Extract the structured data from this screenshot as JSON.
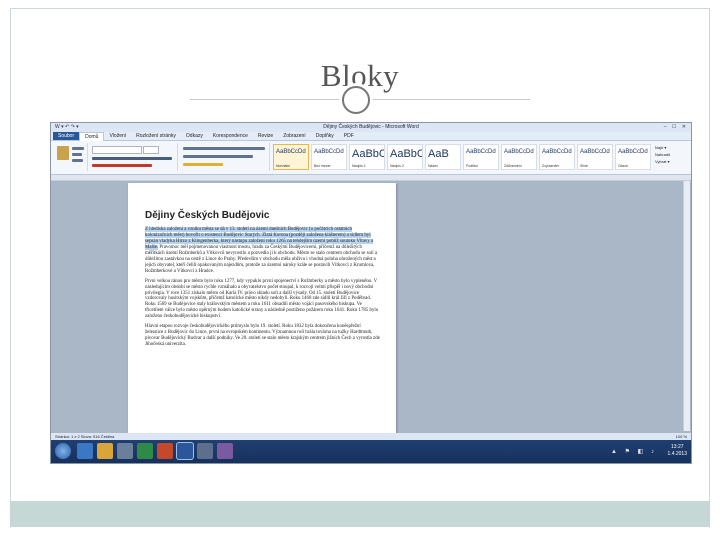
{
  "slide": {
    "title": "Bloky"
  },
  "window": {
    "title": "Dějiny Českých Budějovic - Microsoft Word",
    "qat": "W ▾ ↶ ↷ ▾",
    "controls": "– ☐ ✕"
  },
  "ribbon": {
    "tabs": [
      "Soubor",
      "Domů",
      "Vložení",
      "Rozložení stránky",
      "Odkazy",
      "Korespondence",
      "Revize",
      "Zobrazení",
      "Doplňky",
      "PDF"
    ],
    "active_tab_index": 1,
    "styles": [
      {
        "sample": "AaBbCcDd",
        "name": "Normální",
        "big": false
      },
      {
        "sample": "AaBbCcDd",
        "name": "Bez mezer",
        "big": false
      },
      {
        "sample": "AaBbC",
        "name": "Nadpis 1",
        "big": true
      },
      {
        "sample": "AaBbC",
        "name": "Nadpis 2",
        "big": true
      },
      {
        "sample": "AaB",
        "name": "Název",
        "big": true
      },
      {
        "sample": "AaBbCcDd",
        "name": "Podtitul",
        "big": false
      },
      {
        "sample": "AaBbCcDd",
        "name": "Zdůraznění",
        "big": false
      },
      {
        "sample": "AaBbCcDd",
        "name": "Zvýraznění",
        "big": false
      },
      {
        "sample": "AaBbCcDd",
        "name": "Silné",
        "big": false
      },
      {
        "sample": "AaBbCcDd",
        "name": "Citace",
        "big": false
      }
    ],
    "editing": [
      "Najít ▾",
      "Nahradit",
      "Vybrat ▾"
    ]
  },
  "document": {
    "title": "Dějiny Českých Budějovic",
    "paragraphs": [
      {
        "highlight": "Z hlediska založení a vzniku města se dá v 13. století na území dnešních Budějovic (o počátcích ostatních kolonizačních měst) hovořit o existenci Budějovic Starých. Zlatá Koruna (později založena klášterem) a sídlem byl sepsán vladyka Hirzo z Klingenberka, který nástupu založení roku 1265 na tehdejším území poblíž soutoku Vltavy a Malše.",
        "rest": " Pravomoc měl pojmenovanou vlastnost mostu, hradu za Českými Budějovicemi, přičemž na důležitých měřítkách území Rožmberků a Vítkovců nevyrostlo a pozvedlo ji k obchodu. Město se stalo centrem obchodu se solí a důležitou zastávkou na cestě z Lince do Prahy. Především v obchodu měla obživu i vhodná poloha ohrožených měst a jejich obyvatel, kteří čelili opakovaným nájezdům, protože za územní nároky krále se postavili Vítkovci z Krumlova, Rožmberkové a Vítkovci z Hradce."
      },
      {
        "highlight": "",
        "rest": "První velkou ránou pro město bylo roku 1277, kdy vypuklo první spojenectví s Rožmberky a město bylo vypleněno. V následujícím období se město rychle vzmáhalo a obyvatelstvo počet stoupal, k rozvoji velmi přispěl i nový obchodní privilegia. V roce 1351 získalo město od Karla IV. právo skladu soli a další výsady. Od 15. století Budějovice vzdorovaly husitským vojskům, přičemž katolické město nikdy nedobyli. Roku 1468 zde sídlil král Jiří z Poděbrad. Roku 1569 se Budějovice staly královským městem a roku 1611 obsadili město vojáci pasovského biskupa. Ve třicetileté válce bylo město opěrným bodem katolické strany a následně postiženo požárem roku 1641. Roku 1785 bylo založeno českobudějovické biskupství."
      },
      {
        "highlight": "",
        "rest": "Hlavní etapou rozvoje českobudějovického průmyslu bylo 19. století. Roku 1832 byla dokončena koněspřežní železnice z Budějovic do Lince, první na evropském kontinentu. Významnou roli hrála továrna na tužky Hardtmuth, pivovar Budějovický Budvar a další podniky. Ve 20. století se stalo město krajským centrem jižních Čech a vyrostla zde Jihočeská univerzita."
      }
    ]
  },
  "statusbar": {
    "left": "Stránka: 1 z 2   Slova: 516   Čeština",
    "zoom": "100 %"
  },
  "tray": {
    "icons": "▲ ⚑ ◧ ♪",
    "time": "13:27",
    "date": "1.4.2013"
  },
  "colors": {
    "selection": "#b7d3f2",
    "taskbar": "#1f3f72",
    "bottom_band": "#c6d8d6"
  }
}
